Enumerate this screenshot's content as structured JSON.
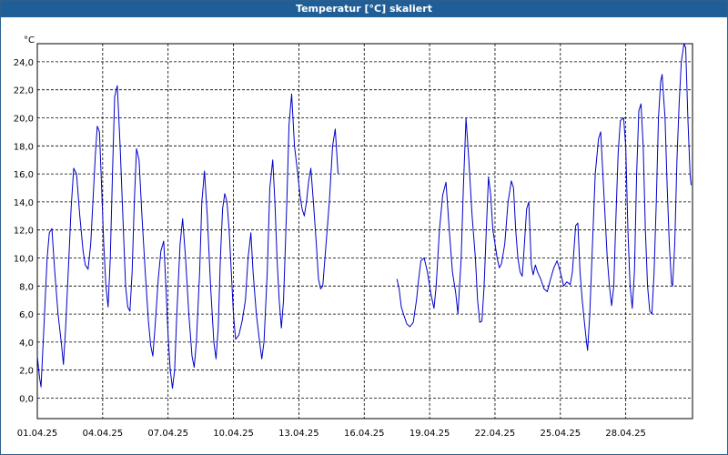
{
  "window": {
    "title": "Temperatur [°C] skaliert"
  },
  "chart_data": {
    "type": "line",
    "title": "Temperatur [°C] skaliert",
    "ylabel": "°C",
    "xlabel": "",
    "xlim": [
      "2025-04-01",
      "2025-05-01"
    ],
    "ylim": [
      -1,
      26
    ],
    "x_ticks": [
      "01.04.25",
      "04.04.25",
      "07.04.25",
      "10.04.25",
      "13.04.25",
      "16.04.25",
      "19.04.25",
      "22.04.25",
      "25.04.25",
      "28.04.25"
    ],
    "y_ticks": [
      "0,0",
      "2,0",
      "4,0",
      "6,0",
      "8,0",
      "10,0",
      "12,0",
      "14,0",
      "16,0",
      "18,0",
      "20,0",
      "22,0",
      "24,0"
    ],
    "grid": true,
    "legend": "none",
    "line_color": "#0000c8",
    "series": [
      {
        "x_unit": "days after 01.04.25",
        "points": [
          [
            0.0,
            3.0
          ],
          [
            0.1,
            1.5
          ],
          [
            0.17,
            0.8
          ],
          [
            0.3,
            5.0
          ],
          [
            0.45,
            10.0
          ],
          [
            0.55,
            11.8
          ],
          [
            0.67,
            12.1
          ],
          [
            0.8,
            9.0
          ],
          [
            0.95,
            6.0
          ],
          [
            1.1,
            4.0
          ],
          [
            1.2,
            2.4
          ],
          [
            1.3,
            5.0
          ],
          [
            1.45,
            10.0
          ],
          [
            1.55,
            13.5
          ],
          [
            1.67,
            16.4
          ],
          [
            1.8,
            16.0
          ],
          [
            1.95,
            13.0
          ],
          [
            2.1,
            10.5
          ],
          [
            2.2,
            9.5
          ],
          [
            2.33,
            9.2
          ],
          [
            2.45,
            11.0
          ],
          [
            2.55,
            14.0
          ],
          [
            2.67,
            17.5
          ],
          [
            2.75,
            19.4
          ],
          [
            2.85,
            19.0
          ],
          [
            2.95,
            15.0
          ],
          [
            3.05,
            11.0
          ],
          [
            3.15,
            8.0
          ],
          [
            3.25,
            6.5
          ],
          [
            3.35,
            10.0
          ],
          [
            3.45,
            16.0
          ],
          [
            3.55,
            21.5
          ],
          [
            3.67,
            22.3
          ],
          [
            3.8,
            18.0
          ],
          [
            3.95,
            12.0
          ],
          [
            4.05,
            8.0
          ],
          [
            4.15,
            6.5
          ],
          [
            4.25,
            6.2
          ],
          [
            4.35,
            9.0
          ],
          [
            4.45,
            14.0
          ],
          [
            4.55,
            17.8
          ],
          [
            4.67,
            17.0
          ],
          [
            4.8,
            13.0
          ],
          [
            4.95,
            9.0
          ],
          [
            5.1,
            5.5
          ],
          [
            5.2,
            3.8
          ],
          [
            5.3,
            3.0
          ],
          [
            5.4,
            5.0
          ],
          [
            5.55,
            8.5
          ],
          [
            5.67,
            10.5
          ],
          [
            5.8,
            11.2
          ],
          [
            5.9,
            8.0
          ],
          [
            6.0,
            4.5
          ],
          [
            6.1,
            2.0
          ],
          [
            6.2,
            0.7
          ],
          [
            6.3,
            2.0
          ],
          [
            6.4,
            6.0
          ],
          [
            6.55,
            11.0
          ],
          [
            6.67,
            12.8
          ],
          [
            6.8,
            10.0
          ],
          [
            6.95,
            6.0
          ],
          [
            7.1,
            3.0
          ],
          [
            7.2,
            2.2
          ],
          [
            7.3,
            4.0
          ],
          [
            7.45,
            9.0
          ],
          [
            7.55,
            14.0
          ],
          [
            7.67,
            16.2
          ],
          [
            7.8,
            13.0
          ],
          [
            7.95,
            8.0
          ],
          [
            8.1,
            4.0
          ],
          [
            8.2,
            2.8
          ],
          [
            8.3,
            5.0
          ],
          [
            8.4,
            10.0
          ],
          [
            8.5,
            13.5
          ],
          [
            8.6,
            14.6
          ],
          [
            8.7,
            14.0
          ],
          [
            8.8,
            12.0
          ],
          [
            8.9,
            9.0
          ],
          [
            9.0,
            6.0
          ],
          [
            9.1,
            4.2
          ],
          [
            9.25,
            4.5
          ],
          [
            9.4,
            5.5
          ],
          [
            9.55,
            7.0
          ],
          [
            9.67,
            10.0
          ],
          [
            9.8,
            11.8
          ],
          [
            9.9,
            9.0
          ],
          [
            10.05,
            6.0
          ],
          [
            10.2,
            4.0
          ],
          [
            10.3,
            2.8
          ],
          [
            10.4,
            4.0
          ],
          [
            10.55,
            9.0
          ],
          [
            10.67,
            15.0
          ],
          [
            10.8,
            17.0
          ],
          [
            10.9,
            14.0
          ],
          [
            11.0,
            10.0
          ],
          [
            11.1,
            7.0
          ],
          [
            11.2,
            5.0
          ],
          [
            11.3,
            7.0
          ],
          [
            11.45,
            14.0
          ],
          [
            11.55,
            19.5
          ],
          [
            11.67,
            21.7
          ],
          [
            11.8,
            18.0
          ],
          [
            11.95,
            16.0
          ],
          [
            12.05,
            14.5
          ],
          [
            12.15,
            13.5
          ],
          [
            12.25,
            13.0
          ],
          [
            12.35,
            14.0
          ],
          [
            12.45,
            15.5
          ],
          [
            12.55,
            16.4
          ],
          [
            12.67,
            14.0
          ],
          [
            12.8,
            11.0
          ],
          [
            12.9,
            8.5
          ],
          [
            13.0,
            7.8
          ],
          [
            13.1,
            8.0
          ],
          [
            13.25,
            11.0
          ],
          [
            13.4,
            14.0
          ],
          [
            13.55,
            18.0
          ],
          [
            13.67,
            19.2
          ],
          [
            13.8,
            16.0
          ]
        ]
      },
      {
        "x_unit": "days after 01.04.25",
        "points": [
          [
            16.5,
            8.5
          ],
          [
            16.6,
            7.8
          ],
          [
            16.7,
            6.5
          ],
          [
            16.8,
            6.0
          ],
          [
            16.95,
            5.3
          ],
          [
            17.1,
            5.1
          ],
          [
            17.25,
            5.4
          ],
          [
            17.4,
            7.0
          ],
          [
            17.5,
            8.5
          ],
          [
            17.6,
            9.8
          ],
          [
            17.75,
            10.0
          ],
          [
            17.9,
            9.0
          ],
          [
            18.05,
            7.5
          ],
          [
            18.2,
            6.4
          ],
          [
            18.3,
            8.0
          ],
          [
            18.45,
            12.0
          ],
          [
            18.6,
            14.5
          ],
          [
            18.75,
            15.4
          ],
          [
            18.9,
            12.0
          ],
          [
            19.05,
            9.0
          ],
          [
            19.2,
            7.5
          ],
          [
            19.3,
            6.0
          ],
          [
            19.45,
            10.0
          ],
          [
            19.55,
            15.0
          ],
          [
            19.67,
            20.0
          ],
          [
            19.8,
            17.0
          ],
          [
            19.95,
            13.0
          ],
          [
            20.1,
            10.0
          ],
          [
            20.2,
            7.0
          ],
          [
            20.3,
            5.4
          ],
          [
            20.4,
            5.5
          ],
          [
            20.5,
            8.0
          ],
          [
            20.6,
            12.0
          ],
          [
            20.7,
            15.8
          ],
          [
            20.8,
            14.5
          ],
          [
            20.9,
            12.0
          ],
          [
            21.0,
            11.0
          ],
          [
            21.1,
            10.0
          ],
          [
            21.2,
            9.3
          ],
          [
            21.3,
            9.6
          ],
          [
            21.45,
            11.0
          ],
          [
            21.6,
            14.0
          ],
          [
            21.75,
            15.5
          ],
          [
            21.85,
            15.0
          ],
          [
            21.95,
            12.0
          ],
          [
            22.05,
            10.0
          ],
          [
            22.15,
            9.0
          ],
          [
            22.25,
            8.7
          ],
          [
            22.35,
            11.0
          ],
          [
            22.45,
            13.5
          ],
          [
            22.55,
            14.0
          ],
          [
            22.6,
            12.0
          ],
          [
            22.67,
            9.5
          ],
          [
            22.75,
            8.8
          ],
          [
            22.85,
            9.5
          ],
          [
            22.95,
            9.0
          ],
          [
            23.1,
            8.5
          ],
          [
            23.25,
            7.8
          ],
          [
            23.4,
            7.6
          ],
          [
            23.55,
            8.5
          ],
          [
            23.7,
            9.3
          ],
          [
            23.85,
            9.8
          ],
          [
            24.0,
            9.0
          ],
          [
            24.15,
            8.0
          ],
          [
            24.3,
            8.3
          ],
          [
            24.45,
            8.1
          ],
          [
            24.55,
            9.0
          ],
          [
            24.7,
            12.3
          ],
          [
            24.8,
            12.5
          ],
          [
            24.9,
            9.0
          ],
          [
            25.0,
            7.0
          ],
          [
            25.1,
            5.5
          ],
          [
            25.2,
            4.0
          ],
          [
            25.25,
            3.4
          ],
          [
            25.35,
            6.0
          ],
          [
            25.5,
            12.0
          ],
          [
            25.6,
            16.0
          ],
          [
            25.75,
            18.5
          ],
          [
            25.85,
            19.0
          ],
          [
            25.95,
            16.0
          ],
          [
            26.05,
            13.0
          ],
          [
            26.15,
            10.0
          ],
          [
            26.25,
            8.0
          ],
          [
            26.35,
            6.6
          ],
          [
            26.45,
            8.0
          ],
          [
            26.55,
            13.0
          ],
          [
            26.65,
            17.5
          ],
          [
            26.75,
            19.8
          ],
          [
            26.9,
            20.0
          ],
          [
            27.0,
            18.0
          ],
          [
            27.1,
            12.0
          ],
          [
            27.2,
            8.0
          ],
          [
            27.3,
            6.4
          ],
          [
            27.4,
            9.0
          ],
          [
            27.5,
            16.0
          ],
          [
            27.6,
            20.5
          ],
          [
            27.7,
            21.0
          ],
          [
            27.8,
            18.0
          ],
          [
            27.9,
            12.0
          ],
          [
            28.0,
            8.0
          ],
          [
            28.1,
            6.2
          ],
          [
            28.2,
            6.0
          ],
          [
            28.3,
            9.0
          ],
          [
            28.4,
            14.0
          ],
          [
            28.5,
            20.0
          ],
          [
            28.6,
            22.6
          ],
          [
            28.67,
            23.1
          ],
          [
            28.8,
            20.0
          ],
          [
            28.9,
            15.0
          ],
          [
            29.0,
            11.0
          ],
          [
            29.1,
            8.2
          ],
          [
            29.15,
            8.0
          ],
          [
            29.25,
            11.0
          ],
          [
            29.35,
            17.0
          ],
          [
            29.45,
            21.0
          ],
          [
            29.55,
            24.0
          ],
          [
            29.67,
            25.3
          ],
          [
            29.75,
            25.0
          ],
          [
            29.85,
            20.0
          ],
          [
            29.95,
            16.0
          ],
          [
            30.0,
            15.2
          ]
        ]
      }
    ]
  }
}
